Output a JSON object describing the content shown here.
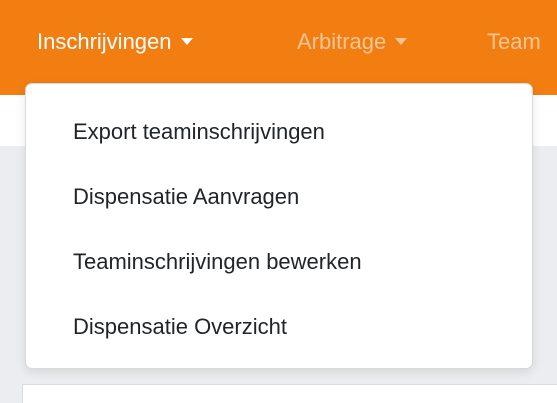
{
  "navbar": {
    "background_color": "#f27e12",
    "items": [
      {
        "label": "Inschrijvingen",
        "active": true,
        "has_dropdown": true,
        "icon": "caret-down-icon"
      },
      {
        "label": "Arbitrage",
        "active": false,
        "has_dropdown": true,
        "icon": "caret-down-icon"
      },
      {
        "label": "Team",
        "active": false,
        "has_dropdown": false
      }
    ]
  },
  "dropdown": {
    "open_for": "Inschrijvingen",
    "items": [
      {
        "label": "Export teaminschrijvingen"
      },
      {
        "label": "Dispensatie Aanvragen"
      },
      {
        "label": "Teaminschrijvingen bewerken"
      },
      {
        "label": "Dispensatie Overzicht"
      }
    ]
  }
}
